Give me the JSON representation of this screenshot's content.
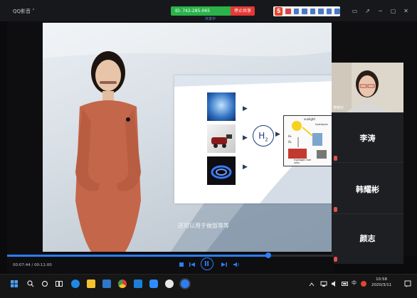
{
  "window": {
    "app_title": "QQ影音 ˅",
    "meeting_id_label": "ID: 742-285-065",
    "stop_share_label": "停止共享",
    "share_mini_label": "共享中"
  },
  "ime": {
    "logo": "S",
    "items": [
      "中",
      "·",
      "◎",
      "⌨",
      "✦",
      "▦",
      "▤"
    ]
  },
  "window_controls": [
    "▭",
    "↗",
    "─",
    "▢",
    "✕"
  ],
  "video": {
    "subtitle": "还可以用于做饭等等",
    "slide": {
      "h2_label": "H",
      "h2_sub": "2",
      "diagram_labels": [
        "sunlight",
        "hydrolysis",
        "H₂",
        "O₂",
        "hydrogen fuel cells"
      ]
    }
  },
  "participants": {
    "camera_name": "李晓玲",
    "tiles": [
      {
        "name": "李涛"
      },
      {
        "name": "韩耀彬"
      },
      {
        "name": "颜志"
      }
    ]
  },
  "player": {
    "current_time": "00:07:44",
    "total_time": "00:11:00",
    "progress_fraction": 0.8,
    "accent": "#2d7df6"
  },
  "taskbar": {
    "tray_ime": "中",
    "clock_time": "10:58",
    "clock_date": "2020/3/11"
  }
}
